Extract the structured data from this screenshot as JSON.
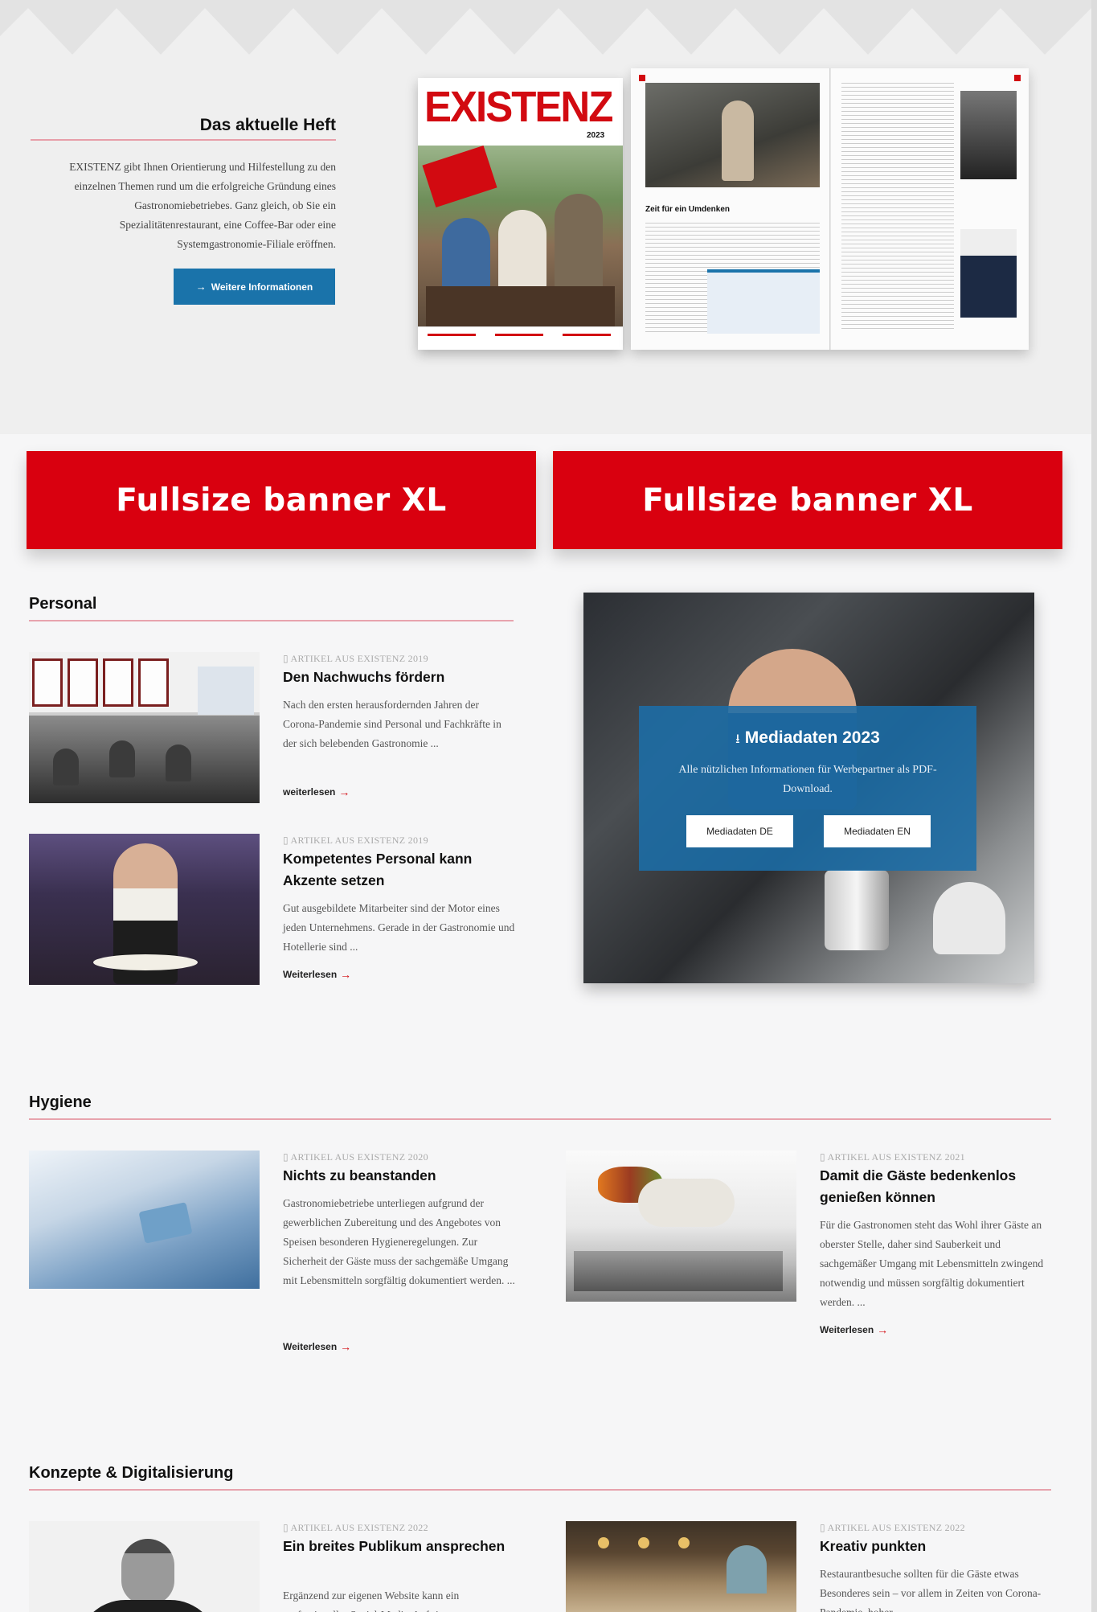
{
  "heft": {
    "title": "Das aktuelle Heft",
    "text": "EXISTENZ gibt Ihnen Orientierung und Hilfestellung zu den einzelnen Themen rund um die erfolgreiche Gründung eines Gastronomiebetriebes. Ganz gleich, ob Sie ein Spezialitätenrestaurant, eine Coffee-Bar oder eine Systemgastronomie-Filiale eröffnen.",
    "button_label": "Weitere Informationen",
    "magazine": {
      "logo": "EXISTENZ",
      "year": "2023",
      "headline": "Zeit für ein Umdenken"
    }
  },
  "banners": [
    "Fullsize banner XL",
    "Fullsize banner XL"
  ],
  "sections": {
    "personal": {
      "title": "Personal",
      "articles": [
        {
          "meta": "ARTIKEL AUS EXISTENZ 2019",
          "title": "Den Nachwuchs fördern",
          "text": "Nach den ersten herausfordernden Jahren der Corona-Pandemie sind Personal und Fachkräfte in der sich belebenden Gastronomie ...",
          "more": "weiterlesen"
        },
        {
          "meta": "ARTIKEL AUS EXISTENZ 2019",
          "title": "Kompetentes Personal kann Akzente setzen",
          "text": "Gut ausgebildete Mitarbeiter sind der Motor eines jeden Unternehmens. Gerade in der Gastronomie und Hotellerie sind ...",
          "more": "Weiterlesen"
        }
      ]
    },
    "hygiene": {
      "title": "Hygiene",
      "articles": [
        {
          "meta": "ARTIKEL AUS EXISTENZ 2020",
          "title": "Nichts zu beanstanden",
          "text": "Gastronomiebetriebe unterliegen aufgrund der gewerblichen Zubereitung und des Angebotes von Speisen besonderen Hygieneregelungen. Zur Sicherheit der Gäste muss der sachgemäße Umgang mit Lebensmitteln sorgfältig dokumentiert werden. ...",
          "more": "Weiterlesen"
        },
        {
          "meta": "ARTIKEL AUS EXISTENZ 2021",
          "title": "Damit die Gäste bedenkenlos genießen können",
          "text": "Für die Gastronomen steht das Wohl ihrer Gäste an oberster Stelle, daher sind Sauberkeit und sachgemäßer Umgang mit Lebensmitteln zwingend notwendig und müssen sorgfältig dokumentiert werden. ...",
          "more": "Weiterlesen"
        }
      ]
    },
    "konzepte": {
      "title": "Konzepte & Digitalisierung",
      "articles": [
        {
          "meta": "ARTIKEL AUS EXISTENZ 2022",
          "title": "Ein breites Publikum ansprechen",
          "text": "Ergänzend zur eigenen Website kann ein professioneller Social-Media-Auftritt"
        },
        {
          "meta": "ARTIKEL AUS EXISTENZ 2022",
          "title": "Kreativ punkten",
          "text": "Restaurantbesuche sollten für die Gäste etwas Besonderes sein – vor allem in Zeiten von Corona-Pandemie, hoher"
        }
      ]
    }
  },
  "mediadaten": {
    "title": "Mediadaten 2023",
    "text": "Alle nützlichen Informationen für Werbepartner als PDF-Download.",
    "btn_de": "Mediadaten DE",
    "btn_en": "Mediadaten EN"
  },
  "colors": {
    "accent_red": "#d9000f",
    "button_blue": "#1a73aa",
    "rule_pink": "#e7a3ad"
  },
  "icons": {
    "arrow": "arrow-right-icon",
    "download": "download-icon",
    "article": "article-icon"
  }
}
